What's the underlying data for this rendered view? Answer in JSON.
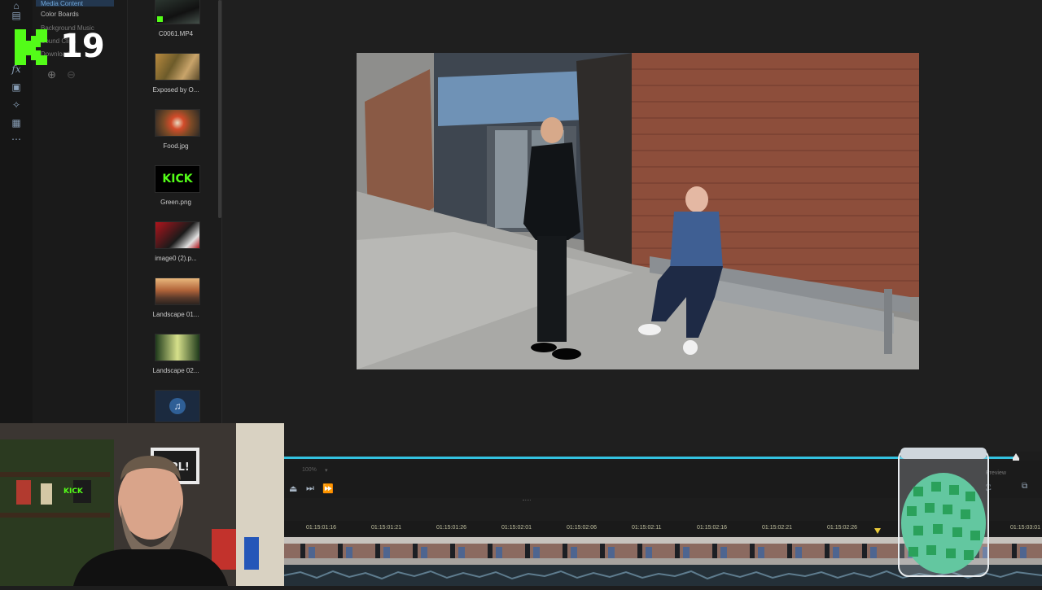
{
  "library": {
    "items": [
      "Media Content",
      "Color Boards",
      "Background Music",
      "Sound Clips",
      "Downloaded"
    ]
  },
  "media": {
    "items": [
      {
        "label": "C0061.MP4"
      },
      {
        "label": "Exposed by O..."
      },
      {
        "label": "Food.jpg"
      },
      {
        "label": "Green.png",
        "thumb_text": "KICK"
      },
      {
        "label": "image0 (2).p..."
      },
      {
        "label": "Landscape 01..."
      },
      {
        "label": "Landscape 02..."
      },
      {
        "label": ""
      }
    ]
  },
  "overlay": {
    "badge_number": "19",
    "logo_letter": "K"
  },
  "timeline": {
    "zoom_label": "100%",
    "right_label": "Preview",
    "timecodes": [
      "01:15:01:16",
      "01:15:01:21",
      "01:15:01:26",
      "01:15:02:01",
      "01:15:02:06",
      "01:15:02:11",
      "01:15:02:16",
      "01:15:02:21",
      "01:15:02:26",
      "01:15:03:01"
    ]
  },
  "webcam": {
    "shirt_text": "KICK",
    "poster_text": "OPL!"
  },
  "colors": {
    "accent": "#33c2e0",
    "kick_green": "#53fc18",
    "panel": "#1a1a1a"
  }
}
